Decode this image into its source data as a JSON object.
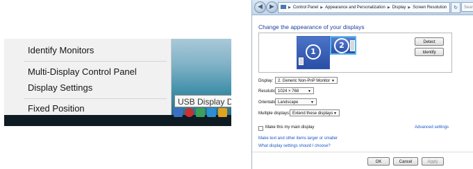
{
  "context_menu": {
    "items": [
      {
        "label": "Identify Monitors"
      },
      {
        "label": "Multi-Display Control Panel"
      },
      {
        "label": "Display Settings"
      },
      {
        "label": "Fixed Position"
      }
    ]
  },
  "taskbar": {
    "tooltip": "USB Display De"
  },
  "control_panel": {
    "breadcrumb": [
      "Control Panel",
      "Appearance and Personalization",
      "Display",
      "Screen Resolution"
    ],
    "search_placeholder": "Search Co",
    "heading": "Change the appearance of your displays",
    "monitors": [
      {
        "number": "1"
      },
      {
        "number": "2"
      }
    ],
    "detect_label": "Detect",
    "identify_label": "Identify",
    "display_label": "Display:",
    "display_value": "2. Generic Non-PnP Monitor",
    "resolution_label": "Resolution:",
    "resolution_value": "1024 × 768",
    "orientation_label": "Orientation:",
    "orientation_value": "Landscape",
    "multiple_label": "Multiple displays:",
    "multiple_value": "Extend these displays",
    "main_display_label": "Make this my main display",
    "advanced_label": "Advanced settings",
    "link_text_size": "Make text and other items larger or smaller",
    "link_which_settings": "What display settings should I choose?",
    "ok_label": "OK",
    "cancel_label": "Cancel",
    "apply_label": "Apply"
  },
  "colors": {
    "heading_blue": "#1e3f9b",
    "link_blue": "#1a56c7",
    "monitor_blue": "#2a4ea6",
    "selection_cyan": "#55b7f0"
  }
}
